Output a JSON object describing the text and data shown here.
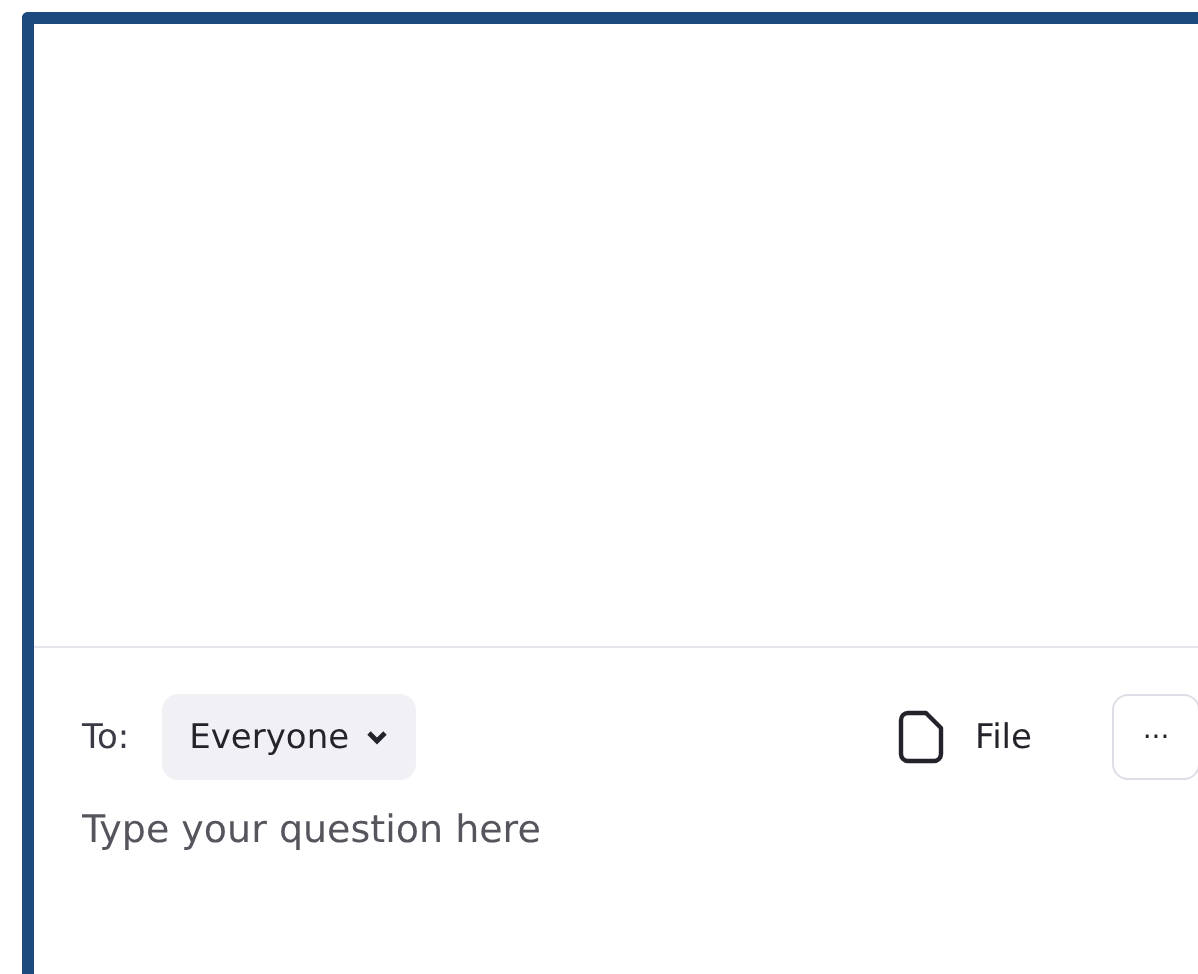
{
  "composer": {
    "to_label": "To:",
    "recipient": "Everyone",
    "file_button": "File",
    "more_button": "···",
    "input": {
      "placeholder": "Type your question here"
    }
  }
}
